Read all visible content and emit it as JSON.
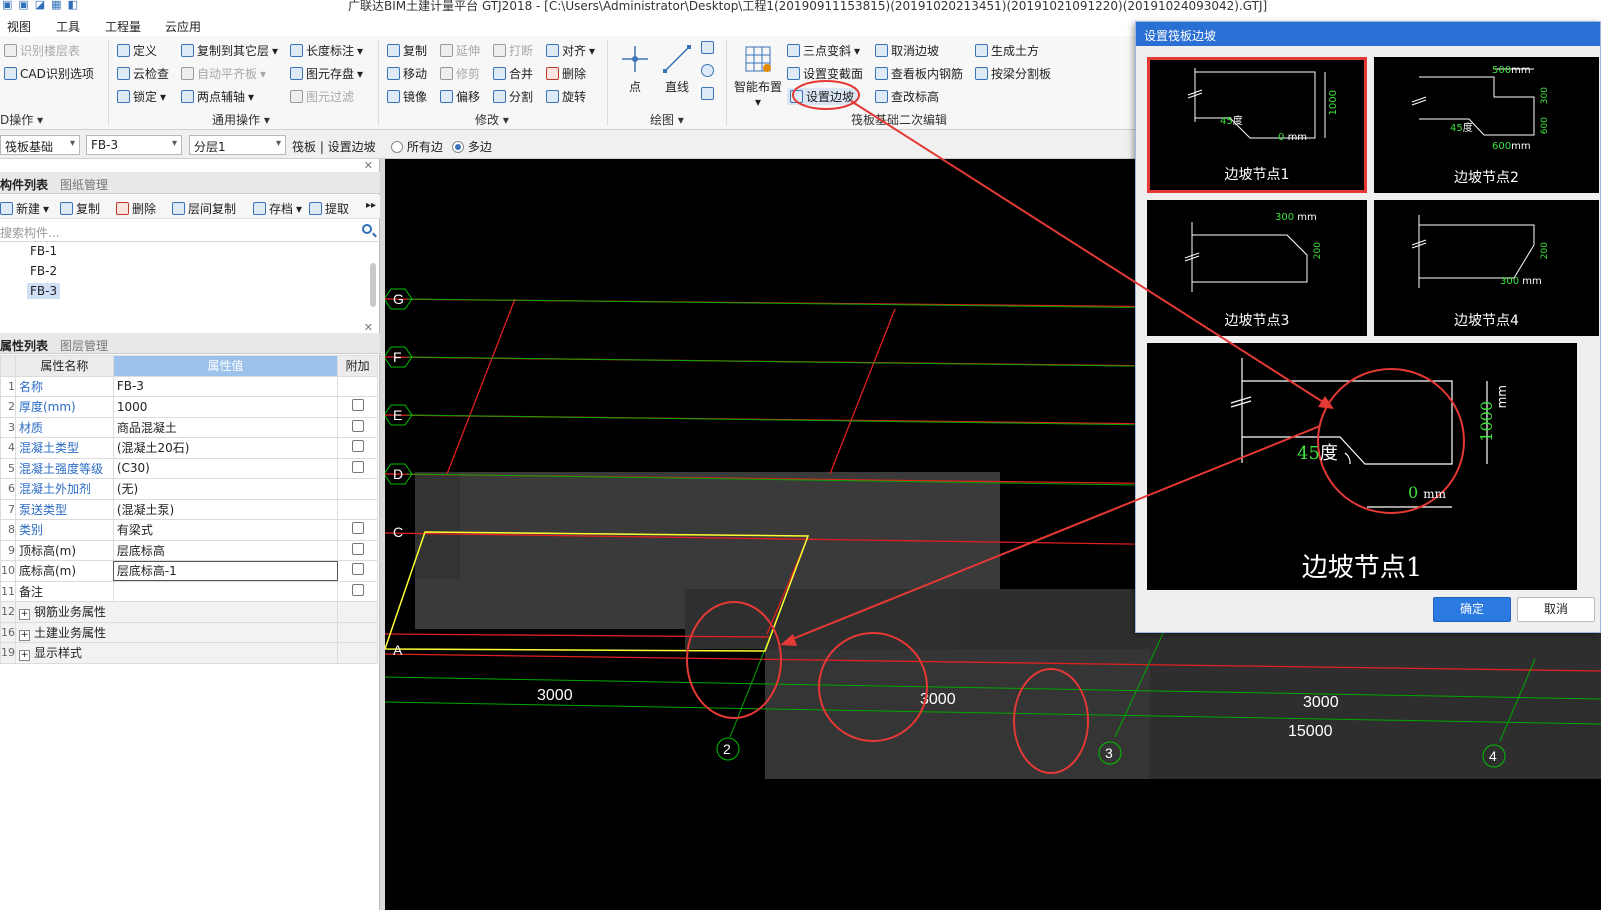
{
  "window": {
    "title": "广联达BIM土建计量平台 GTJ2018 - [C:\\Users\\Administrator\\Desktop\\工程1(20190911153815)(20191020213451)(20191021091220)(20191024093042).GTJ]"
  },
  "menu": [
    "视图",
    "工具",
    "工程量",
    "云应用"
  ],
  "ribbon": {
    "col1": [
      "识别楼层表",
      "CAD识别选项"
    ],
    "col1_group": "D操作",
    "col2": [
      "定义",
      "云检查",
      "锁定"
    ],
    "col3": [
      "复制到其它层",
      "自动平齐板",
      "两点辅轴"
    ],
    "col4": [
      "长度标注",
      "图元存盘",
      "图元过滤"
    ],
    "general_group": "通用操作",
    "modify1": [
      "复制",
      "移动",
      "镜像"
    ],
    "modify2": [
      "延伸",
      "修剪",
      "偏移"
    ],
    "modify3": [
      "打断",
      "合并",
      "分割"
    ],
    "modify4": [
      "对齐",
      "删除",
      "旋转"
    ],
    "modify_group": "修改",
    "draw": [
      "点",
      "直线"
    ],
    "draw_group": "绘图",
    "smart_layout": "智能布置",
    "raft1": [
      "三点变斜",
      "设置变截面",
      "设置边坡"
    ],
    "raft2": [
      "取消边坡",
      "查看板内钢筋",
      "查改标高"
    ],
    "raft3": [
      "生成土方",
      "按梁分割板"
    ],
    "raft_group": "筏板基础二次编辑"
  },
  "selector": {
    "category": "筏板基础",
    "component": "FB-3",
    "floor": "分层1",
    "breadcrumb": "筏板 | 设置边坡",
    "radio_all": "所有边",
    "radio_multi": "多边",
    "selected_mode": "多边"
  },
  "component_panel": {
    "tabs": [
      "构件列表",
      "图纸管理"
    ],
    "toolbar": [
      "新建",
      "复制",
      "删除",
      "层间复制",
      "存档",
      "提取"
    ],
    "search_placeholder": "搜索构件...",
    "items": [
      "FB-1",
      "FB-2",
      "FB-3"
    ],
    "selected": "FB-3"
  },
  "properties_panel": {
    "tabs": [
      "属性列表",
      "图层管理"
    ],
    "headers": [
      "属性名称",
      "属性值",
      "附加"
    ],
    "rows": [
      {
        "num": "1",
        "name": "名称",
        "value": "FB-3",
        "check": false,
        "blue": true
      },
      {
        "num": "2",
        "name": "厚度(mm)",
        "value": "1000",
        "check": true,
        "blue": true
      },
      {
        "num": "3",
        "name": "材质",
        "value": "商品混凝土",
        "check": true,
        "blue": true
      },
      {
        "num": "4",
        "name": "混凝土类型",
        "value": "(混凝土20石)",
        "check": true,
        "blue": true
      },
      {
        "num": "5",
        "name": "混凝土强度等级",
        "value": "(C30)",
        "check": true,
        "blue": true
      },
      {
        "num": "6",
        "name": "混凝土外加剂",
        "value": "(无)",
        "check": false,
        "blue": true
      },
      {
        "num": "7",
        "name": "泵送类型",
        "value": "(混凝土泵)",
        "check": false,
        "blue": true
      },
      {
        "num": "8",
        "name": "类别",
        "value": "有梁式",
        "check": true,
        "blue": true
      },
      {
        "num": "9",
        "name": "顶标高(m)",
        "value": "层底标高",
        "check": true,
        "blue": false
      },
      {
        "num": "10",
        "name": "底标高(m)",
        "value": "层底标高-1",
        "check": true,
        "blue": false
      },
      {
        "num": "11",
        "name": "备注",
        "value": "",
        "check": true,
        "blue": false
      }
    ],
    "groups": [
      {
        "num": "12",
        "name": "钢筋业务属性"
      },
      {
        "num": "16",
        "name": "土建业务属性"
      },
      {
        "num": "19",
        "name": "显示样式"
      }
    ]
  },
  "viewport": {
    "axis_rows": [
      "G",
      "F",
      "E",
      "D",
      "C",
      "A"
    ],
    "axis_cols": [
      "2",
      "3",
      "4"
    ],
    "dimensions": [
      "3000",
      "3000",
      "3000",
      "15000"
    ]
  },
  "dialog": {
    "title": "设置筏板边坡",
    "tiles": [
      "边坡节点1",
      "边坡节点2",
      "边坡节点3",
      "边坡节点4"
    ],
    "selected_tile": "边坡节点1",
    "tile1": {
      "angle": "45",
      "angle_unit": "度",
      "thickness": "1000",
      "unit": "mm",
      "offset": "0"
    },
    "tile2": {
      "top": "500",
      "height1": "300",
      "height2": "600",
      "bottom": "600",
      "angle": "45",
      "angle_unit": "度",
      "unit": "mm"
    },
    "tile3": {
      "width": "300",
      "height": "200",
      "unit": "mm"
    },
    "tile4": {
      "width": "300",
      "height": "200",
      "unit": "mm"
    },
    "preview": {
      "caption": "边坡节点1",
      "angle": "45",
      "angle_unit": "度",
      "thickness": "1000",
      "unit": "mm",
      "offset": "0"
    },
    "ok_label": "确定",
    "cancel_label": "取消"
  },
  "colors": {
    "accent": "#2a6fd3",
    "annotation": "#e53935",
    "axis_green": "#00c000",
    "slab_outline": "#ffff33"
  }
}
